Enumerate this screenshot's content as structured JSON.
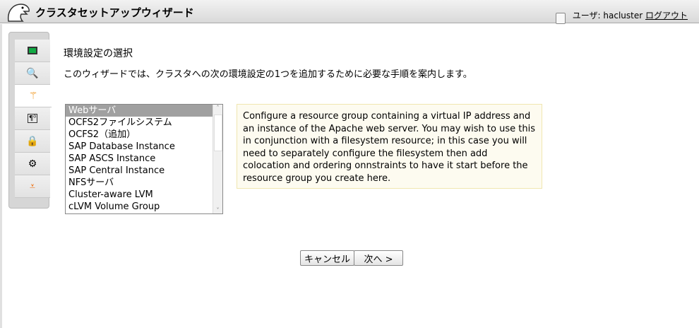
{
  "header": {
    "title": "クラスタセットアップウィザード",
    "user_label": "ユーザ: hacluster",
    "logout": "ログアウト"
  },
  "nav": {
    "icons": [
      "monitor-icon",
      "scroll-search-icon",
      "wizard-wand-icon",
      "configure-icon",
      "lock-icon",
      "gears-icon",
      "network-icon"
    ]
  },
  "main": {
    "heading": "環境設定の選択",
    "description": "このウィザードでは、クラスタへの次の環境設定の1つを追加するために必要な手順を案内します。",
    "options": [
      "Webサーバ",
      "OCFS2ファイルシステム",
      "OCFS2（追加）",
      "SAP Database Instance",
      "SAP ASCS Instance",
      "SAP Central Instance",
      "NFSサーバ",
      "Cluster-aware LVM",
      "cLVM Volume Group"
    ],
    "selected": "Webサーバ",
    "info": "Configure a resource group containing a virtual IP address and an instance of the Apache web server. You may wish to use this in conjunction with a filesystem resource; in this case you will need to separately configure the filesystem then add colocation and ordering onnstraints to have it start before the resource group you create here.",
    "cancel": "キャンセル",
    "next": "次へ >"
  }
}
